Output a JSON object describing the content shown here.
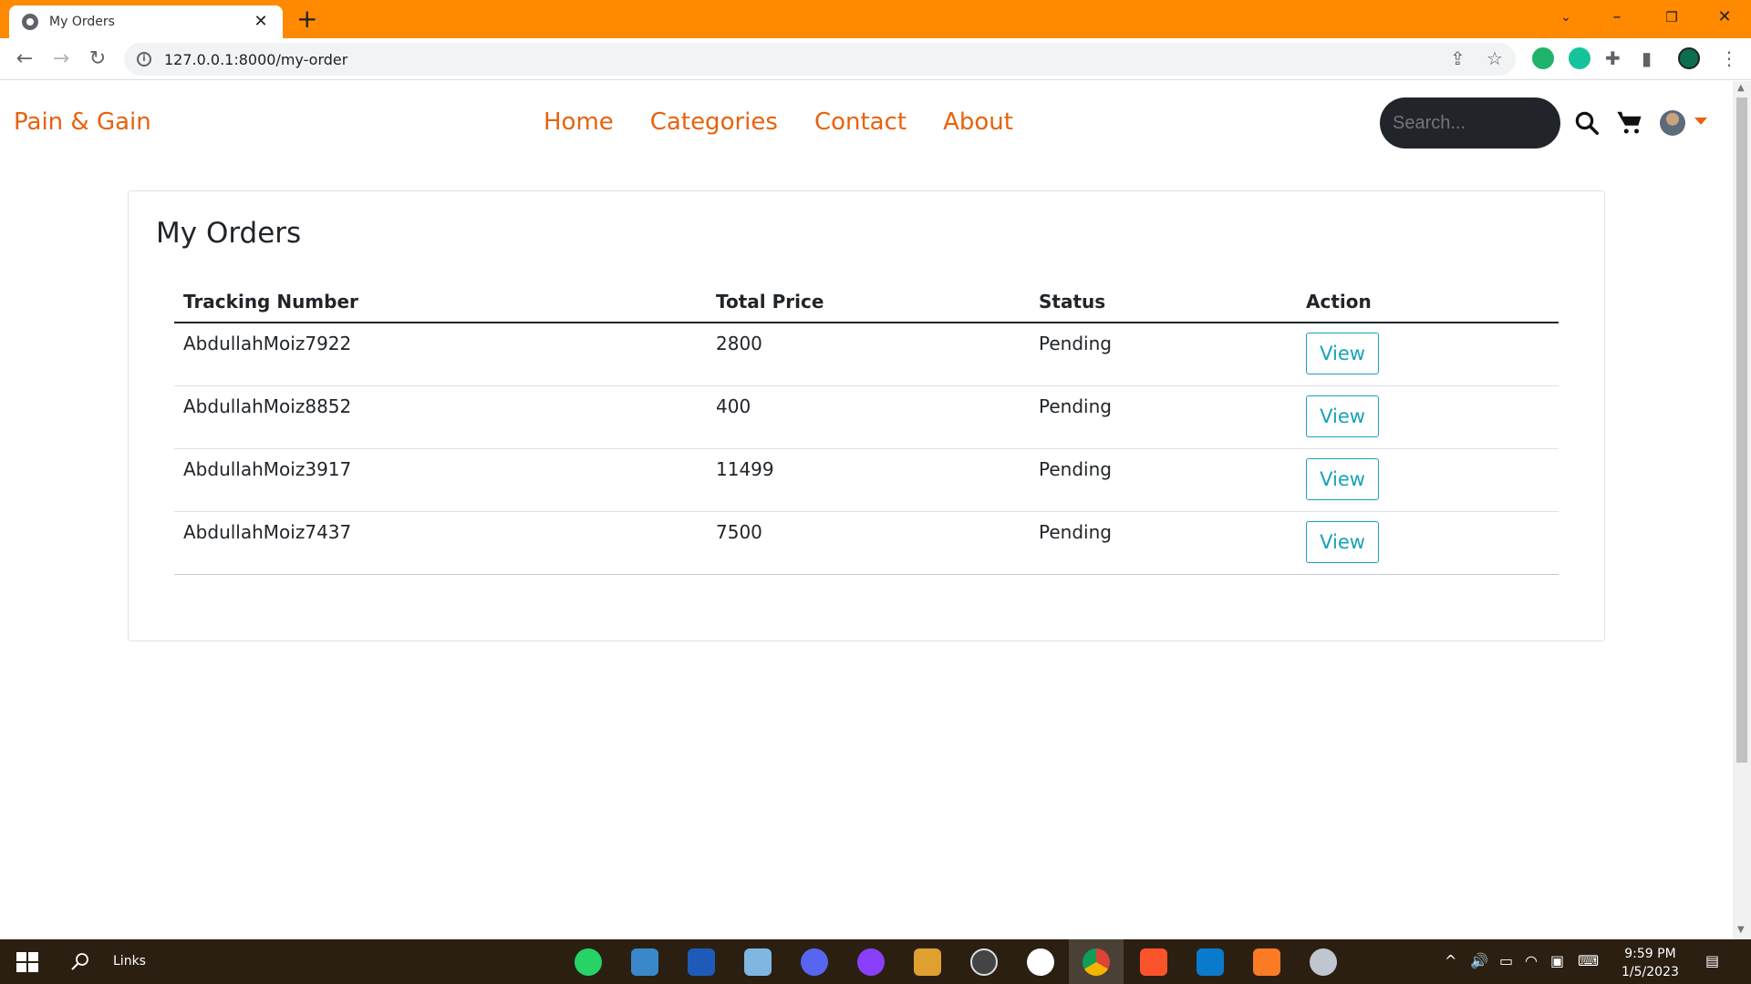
{
  "browser": {
    "tab_title": "My Orders",
    "url": "127.0.0.1:8000/my-order",
    "new_tab": "+"
  },
  "site": {
    "brand": "Pain & Gain",
    "nav": [
      "Home",
      "Categories",
      "Contact",
      "About"
    ],
    "search_placeholder": "Search...",
    "accent_color": "#e8620c"
  },
  "orders": {
    "title": "My Orders",
    "headers": [
      "Tracking Number",
      "Total Price",
      "Status",
      "Action"
    ],
    "rows": [
      {
        "tracking": "AbdullahMoiz7922",
        "price": "2800",
        "status": "Pending",
        "action": "View"
      },
      {
        "tracking": "AbdullahMoiz8852",
        "price": "400",
        "status": "Pending",
        "action": "View"
      },
      {
        "tracking": "AbdullahMoiz3917",
        "price": "11499",
        "status": "Pending",
        "action": "View"
      },
      {
        "tracking": "AbdullahMoiz7437",
        "price": "7500",
        "status": "Pending",
        "action": "View"
      }
    ]
  },
  "taskbar": {
    "links_label": "Links",
    "time": "9:59 PM",
    "date": "1/5/2023"
  }
}
